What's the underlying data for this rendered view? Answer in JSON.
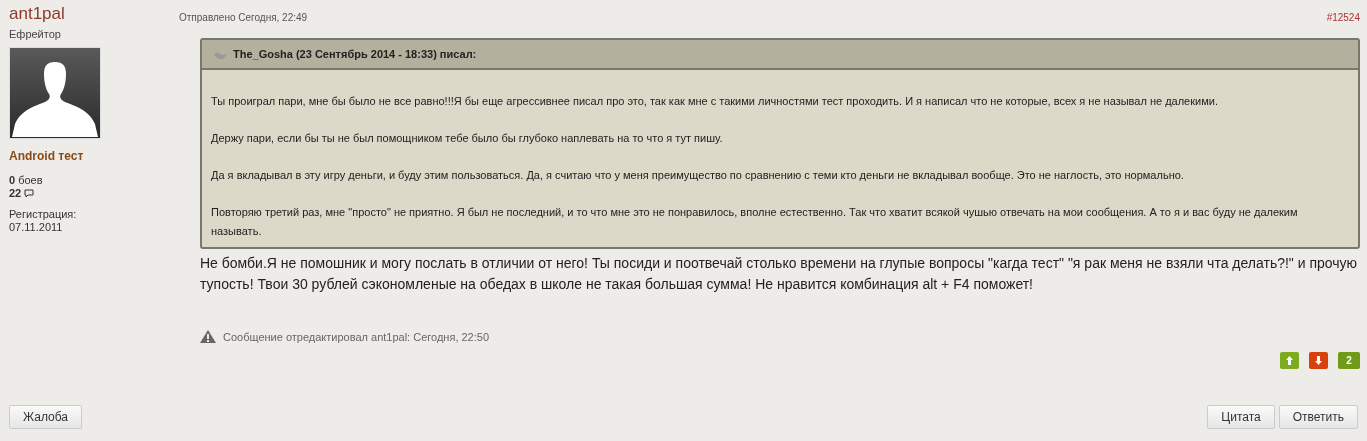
{
  "author": {
    "name": "ant1pal",
    "rank": "Ефрейтор",
    "group": "Android тест",
    "battles_count": "0",
    "battles_label": "боев",
    "posts_count": "22",
    "registration_label": "Регистрация:",
    "registration_date": "07.11.2011"
  },
  "post": {
    "sent": "Отправлено Сегодня, 22:49",
    "number": "#12524",
    "quote": {
      "header": "The_Gosha (23 Сентябрь 2014 - 18:33) писал:",
      "paragraphs": [
        "Ты проиграл пари, мне бы было не все равно!!!Я бы еще агрессивнее писал про это, так как мне с такими личностями тест проходить. И я написал что не которые, всех я не называл не далекими.",
        "Держу пари, если бы ты не был помощником тебе было бы глубоко наплевать на то что я тут пишу.",
        "Да я вкладывал в эту игру деньги, и буду этим пользоваться. Да, я считаю что у меня преимущество по сравнению с теми кто деньги не вкладывал вообще. Это не наглость, это нормально.",
        "Повторяю третий раз, мне \"просто\" не приятно. Я был не последний, и то что мне это не понравилось, вполне естественно. Так что хватит всякой чушью отвечать на мои сообщения. А то я и вас буду не далеким называть."
      ]
    },
    "text": "Не бомби.Я не помошник и могу послать в отличии от него! Ты посиди и поотвечай столько времени на глупые вопросы \"кагда тест\" \"я рак меня не взяли чта делать?!\" и прочую тупость! Твои 30 рублей сэкономленые на обедах в школе не такая большая сумма! Не нравится комбинация alt + F4 поможет!",
    "edited": "Сообщение отредактировал ant1pal: Сегодня, 22:50",
    "rating": "2"
  },
  "buttons": {
    "report": "Жалоба",
    "quote": "Цитата",
    "reply": "Ответить"
  }
}
